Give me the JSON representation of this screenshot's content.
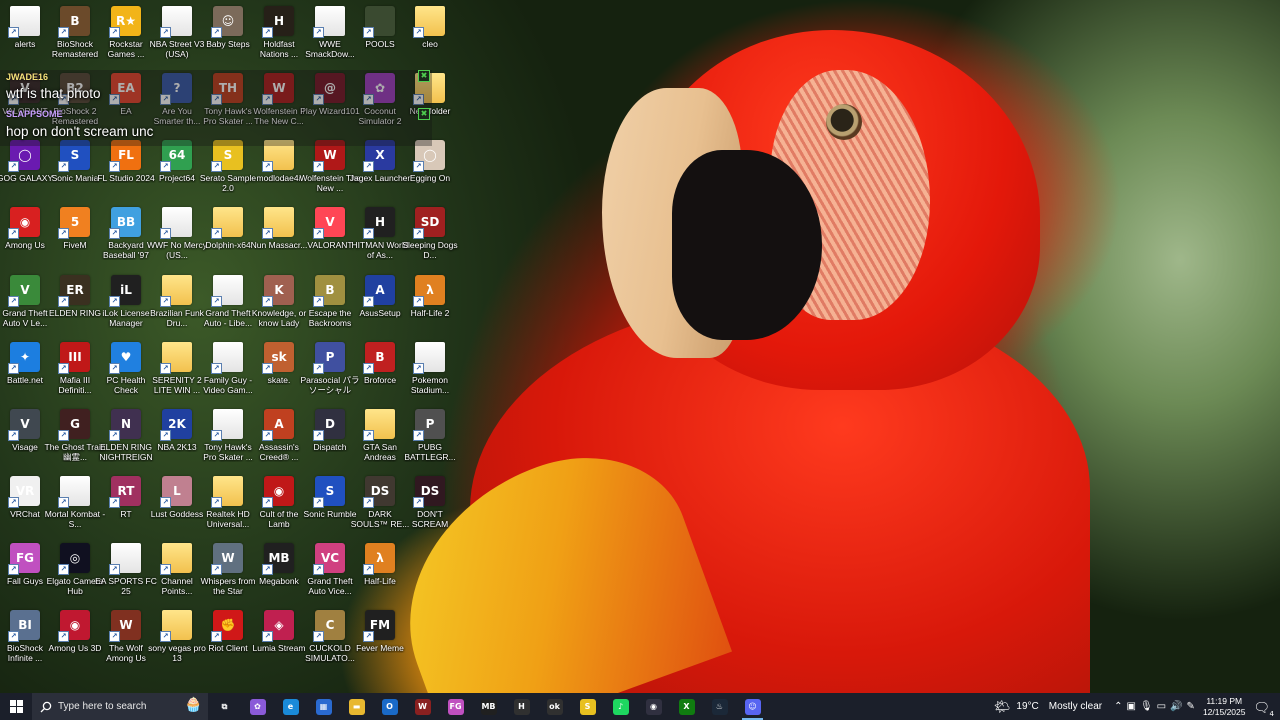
{
  "desktop": {
    "icons": [
      {
        "label": "alerts",
        "glyph": "",
        "bg": "file"
      },
      {
        "label": "BioShock Remastered",
        "glyph": "B",
        "bg": "#6b4a2a"
      },
      {
        "label": "Rockstar Games ...",
        "glyph": "R★",
        "bg": "#f2b418"
      },
      {
        "label": "NBA Street V3 (USA)",
        "glyph": "",
        "bg": "file"
      },
      {
        "label": "Baby Steps",
        "glyph": "☺",
        "bg": "#7b6a5a"
      },
      {
        "label": "Holdfast Nations ...",
        "glyph": "H",
        "bg": "#262018"
      },
      {
        "label": "WWE SmackDow...",
        "glyph": "",
        "bg": "file"
      },
      {
        "label": "POOLS",
        "glyph": "",
        "bg": "#3a4a30"
      },
      {
        "label": "cleo",
        "glyph": "",
        "bg": "folder"
      },
      {
        "label": "VALORANT",
        "glyph": "V",
        "bg": "#3a2a2a"
      },
      {
        "label": "BioShock 2 Remastered",
        "glyph": "B2",
        "bg": "#5a4a3a"
      },
      {
        "label": "EA",
        "glyph": "EA",
        "bg": "#e8452e"
      },
      {
        "label": "Are You Smarter th...",
        "glyph": "?",
        "bg": "#3a5aa8"
      },
      {
        "label": "Tony Hawk's Pro Skater ...",
        "glyph": "TH",
        "bg": "#c04020"
      },
      {
        "label": "Wolfenstein II The New C...",
        "glyph": "W",
        "bg": "#b02020"
      },
      {
        "label": "Play Wizard101",
        "glyph": "@",
        "bg": "#7a1a2a"
      },
      {
        "label": "Coconut Simulator 2",
        "glyph": "✿",
        "bg": "#a040c0"
      },
      {
        "label": "New folder",
        "glyph": "",
        "bg": "folder"
      },
      {
        "label": "GOG GALAXY",
        "glyph": "◯",
        "bg": "#6a1ab0"
      },
      {
        "label": "Sonic Mania",
        "glyph": "S",
        "bg": "#2050c0"
      },
      {
        "label": "FL Studio 2024",
        "glyph": "FL",
        "bg": "#f07010"
      },
      {
        "label": "Project64",
        "glyph": "64",
        "bg": "#30a050"
      },
      {
        "label": "Serato Sample 2.0",
        "glyph": "S",
        "bg": "#e8c020"
      },
      {
        "label": "modlodae4r",
        "glyph": "",
        "bg": "folder"
      },
      {
        "label": "Wolfenstein The New ...",
        "glyph": "W",
        "bg": "#b01818"
      },
      {
        "label": "Jagex Launcher",
        "glyph": "X",
        "bg": "#2a3aa0"
      },
      {
        "label": "Egging On",
        "glyph": "◯",
        "bg": "#d8c8b8"
      },
      {
        "label": "Among Us",
        "glyph": "◉",
        "bg": "#d82020"
      },
      {
        "label": "FiveM",
        "glyph": "5",
        "bg": "#f08020"
      },
      {
        "label": "Backyard Baseball '97",
        "glyph": "BB",
        "bg": "#40a0e0"
      },
      {
        "label": "WWF No Mercy (US...",
        "glyph": "",
        "bg": "file"
      },
      {
        "label": "Dolphin-x64",
        "glyph": "",
        "bg": "folder"
      },
      {
        "label": "Nun Massacr...",
        "glyph": "",
        "bg": "folder"
      },
      {
        "label": "VALORANT",
        "glyph": "V",
        "bg": "#ff4655"
      },
      {
        "label": "HITMAN World of As...",
        "glyph": "H",
        "bg": "#202020"
      },
      {
        "label": "Sleeping Dogs D...",
        "glyph": "SD",
        "bg": "#a02020"
      },
      {
        "label": "Grand Theft Auto V Le...",
        "glyph": "V",
        "bg": "#3a8a3a"
      },
      {
        "label": "ELDEN RING",
        "glyph": "ER",
        "bg": "#3a3020"
      },
      {
        "label": "iLok License Manager",
        "glyph": "iL",
        "bg": "#202020"
      },
      {
        "label": "Brazilian Funk Dru...",
        "glyph": "",
        "bg": "folder"
      },
      {
        "label": "Grand Theft Auto - Libe...",
        "glyph": "",
        "bg": "file"
      },
      {
        "label": "Knowledge, or know Lady",
        "glyph": "K",
        "bg": "#a06050"
      },
      {
        "label": "Escape the Backrooms",
        "glyph": "B",
        "bg": "#a09040"
      },
      {
        "label": "AsusSetup",
        "glyph": "A",
        "bg": "#2040a0"
      },
      {
        "label": "Half-Life 2",
        "glyph": "λ",
        "bg": "#e08020"
      },
      {
        "label": "Battle.net",
        "glyph": "✦",
        "bg": "#1c7ee0"
      },
      {
        "label": "Mafia III Definiti...",
        "glyph": "III",
        "bg": "#c01818"
      },
      {
        "label": "PC Health Check",
        "glyph": "♥",
        "bg": "#2080e0"
      },
      {
        "label": "SERENITY 2 LITE WIN ...",
        "glyph": "",
        "bg": "folder"
      },
      {
        "label": "Family Guy - Video Gam...",
        "glyph": "",
        "bg": "file"
      },
      {
        "label": "skate.",
        "glyph": "sk",
        "bg": "#c06030"
      },
      {
        "label": "Parasocial パラソーシャル",
        "glyph": "P",
        "bg": "#4050a0"
      },
      {
        "label": "Broforce",
        "glyph": "B",
        "bg": "#c02020"
      },
      {
        "label": "Pokemon Stadium...",
        "glyph": "",
        "bg": "file"
      },
      {
        "label": "Visage",
        "glyph": "V",
        "bg": "#404850"
      },
      {
        "label": "The Ghost Train 幽霊...",
        "glyph": "G",
        "bg": "#402020"
      },
      {
        "label": "ELDEN RING NIGHTREIGN",
        "glyph": "N",
        "bg": "#403050"
      },
      {
        "label": "NBA 2K13",
        "glyph": "2K",
        "bg": "#2040a0"
      },
      {
        "label": "Tony Hawk's Pro Skater ...",
        "glyph": "",
        "bg": "file"
      },
      {
        "label": "Assassin's Creed® ...",
        "glyph": "A",
        "bg": "#c04020"
      },
      {
        "label": "Dispatch",
        "glyph": "D",
        "bg": "#303040"
      },
      {
        "label": "GTA San Andreas",
        "glyph": "",
        "bg": "folder"
      },
      {
        "label": "PUBG BATTLEGR...",
        "glyph": "P",
        "bg": "#505050"
      },
      {
        "label": "VRChat",
        "glyph": "VR",
        "bg": "#f0f0f0"
      },
      {
        "label": "Mortal Kombat - S...",
        "glyph": "",
        "bg": "file"
      },
      {
        "label": "RT",
        "glyph": "RT",
        "bg": "#a03060"
      },
      {
        "label": "Lust Goddess",
        "glyph": "L",
        "bg": "#c08090"
      },
      {
        "label": "Realtek HD Universal...",
        "glyph": "",
        "bg": "folder"
      },
      {
        "label": "Cult of the Lamb",
        "glyph": "◉",
        "bg": "#c01818"
      },
      {
        "label": "Sonic Rumble",
        "glyph": "S",
        "bg": "#2050c0"
      },
      {
        "label": "DARK SOULS™ RE...",
        "glyph": "DS",
        "bg": "#403830"
      },
      {
        "label": "DON'T SCREAM",
        "glyph": "DS",
        "bg": "#301820"
      },
      {
        "label": "Fall Guys",
        "glyph": "FG",
        "bg": "#c050c0"
      },
      {
        "label": "Elgato Camera Hub",
        "glyph": "◎",
        "bg": "#101020"
      },
      {
        "label": "EA SPORTS FC 25",
        "glyph": "",
        "bg": "file"
      },
      {
        "label": "Channel Points...",
        "glyph": "",
        "bg": "folder"
      },
      {
        "label": "Whispers from the Star",
        "glyph": "W",
        "bg": "#607080"
      },
      {
        "label": "Megabonk",
        "glyph": "MB",
        "bg": "#202020"
      },
      {
        "label": "Grand Theft Auto Vice...",
        "glyph": "VC",
        "bg": "#d04080"
      },
      {
        "label": "Half-Life",
        "glyph": "λ",
        "bg": "#e08020"
      },
      {
        "label": "",
        "glyph": "",
        "bg": "none"
      },
      {
        "label": "BioShock Infinite ...",
        "glyph": "BI",
        "bg": "#5a7090"
      },
      {
        "label": "Among Us 3D",
        "glyph": "◉",
        "bg": "#c01830"
      },
      {
        "label": "The Wolf Among Us",
        "glyph": "W",
        "bg": "#803020"
      },
      {
        "label": "sony vegas pro 13",
        "glyph": "",
        "bg": "folder"
      },
      {
        "label": "Riot Client",
        "glyph": "✊",
        "bg": "#d01818"
      },
      {
        "label": "Lumia Stream",
        "glyph": "◈",
        "bg": "#c02050"
      },
      {
        "label": "CUCKOLD SIMULATO...",
        "glyph": "C",
        "bg": "#a08040"
      },
      {
        "label": "Fever Meme",
        "glyph": "FM",
        "bg": "#202020"
      },
      {
        "label": "",
        "glyph": "",
        "bg": "none"
      }
    ]
  },
  "chat": {
    "user1": "JWADE16",
    "message1": "wtf is that photo",
    "user2": "SLAPPSOME",
    "message2": "hop on don't scream unc"
  },
  "taskbar": {
    "search_placeholder": "Type here to search",
    "apps": [
      {
        "name": "task-view",
        "glyph": "⧉",
        "bg": "transparent"
      },
      {
        "name": "copilot",
        "glyph": "✿",
        "bg": "#8a5ad8"
      },
      {
        "name": "edge",
        "glyph": "e",
        "bg": "#1a8ad8"
      },
      {
        "name": "store",
        "glyph": "▦",
        "bg": "#2a6ad0"
      },
      {
        "name": "file-explorer",
        "glyph": "▬",
        "bg": "#e8b830"
      },
      {
        "name": "outlook",
        "glyph": "O",
        "bg": "#1a6ac8"
      },
      {
        "name": "game",
        "glyph": "W",
        "bg": "#8a2020"
      },
      {
        "name": "fall-guys",
        "glyph": "FG",
        "bg": "#c050c0"
      },
      {
        "name": "megabonk",
        "glyph": "MB",
        "bg": "#202020"
      },
      {
        "name": "hitman",
        "glyph": "H",
        "bg": "#303030"
      },
      {
        "name": "okami",
        "glyph": "ok",
        "bg": "#303030"
      },
      {
        "name": "serato",
        "glyph": "S",
        "bg": "#e8c020"
      },
      {
        "name": "spotify",
        "glyph": "♪",
        "bg": "#1ed760"
      },
      {
        "name": "obs",
        "glyph": "◉",
        "bg": "#303040"
      },
      {
        "name": "xbox",
        "glyph": "X",
        "bg": "#107c10"
      },
      {
        "name": "steam",
        "glyph": "♨",
        "bg": "#1b2838"
      },
      {
        "name": "discord",
        "glyph": "☺",
        "bg": "#5865f2"
      }
    ],
    "weather_temp": "19°C",
    "weather_text": "Mostly clear",
    "time": "11:19 PM",
    "date": "12/15/2025",
    "notifications_count": "4"
  }
}
